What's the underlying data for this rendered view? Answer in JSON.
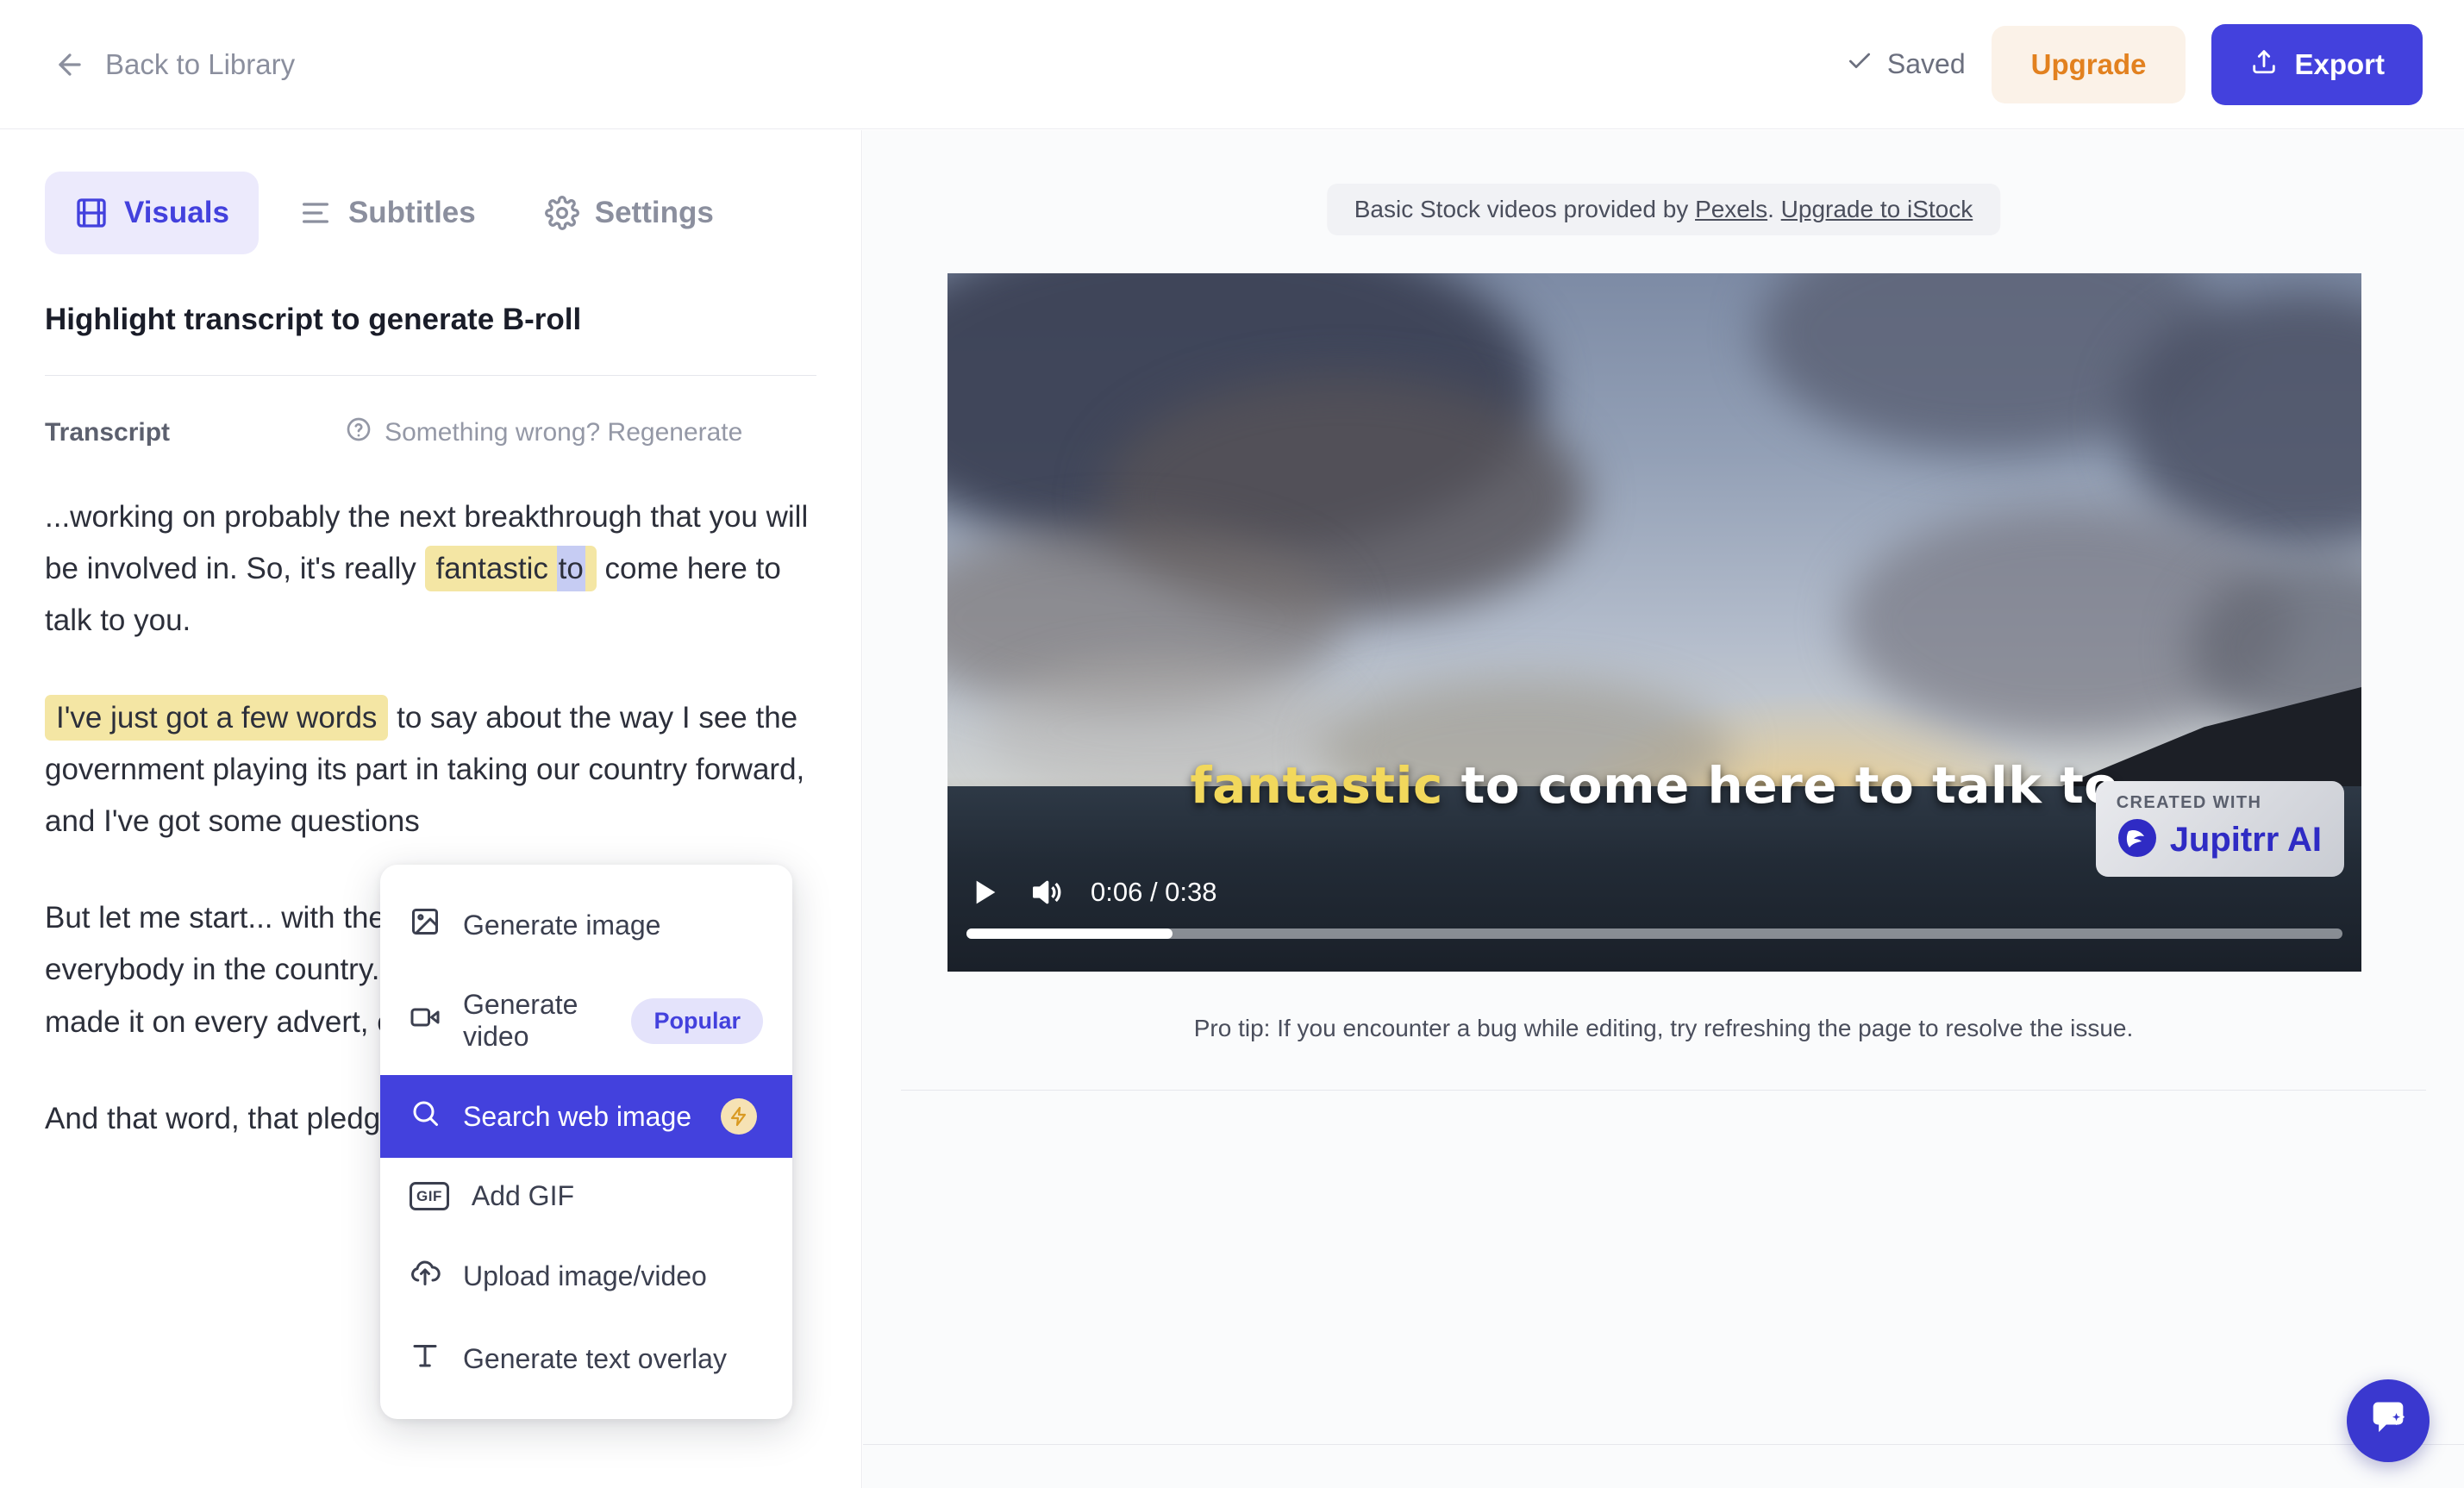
{
  "header": {
    "back_label": "Back to Library",
    "saved_label": "Saved",
    "upgrade_label": "Upgrade",
    "export_label": "Export",
    "accent_blue": "#4341dd",
    "accent_orange": "#e2811f"
  },
  "tabs": [
    {
      "label": "Visuals",
      "icon": "film-icon",
      "active": true
    },
    {
      "label": "Subtitles",
      "icon": "lines-icon",
      "active": false
    },
    {
      "label": "Settings",
      "icon": "gear-icon",
      "active": false
    }
  ],
  "panel": {
    "title": "Highlight transcript to generate B-roll",
    "transcript_label": "Transcript",
    "regenerate_label": "Something wrong? Regenerate"
  },
  "transcript": {
    "p1_a": "...working on probably the next breakthrough that you will be involved in. So, it's really ",
    "p1_hl_yellow": "fantastic ",
    "p1_hl_blue": "to",
    "p1_b": " come here to talk to you.",
    "p2_hl": "I've just got a few words",
    "p2_rest": " to say about the way I see the government playing its part in taking our country forward, and I've got some questions",
    "p3": "But let me start... with the pledge I made to you and everybody in the country. It was a really simple pledge. I made it on every advert, on every speech.",
    "p4": "And that word, that pledge"
  },
  "context_menu": {
    "items": [
      {
        "label": "Generate image",
        "icon": "image-icon",
        "badge": "",
        "highlighted": false
      },
      {
        "label": "Generate video",
        "icon": "video-camera-icon",
        "badge": "Popular",
        "highlighted": false
      },
      {
        "label": "Search web image",
        "icon": "search-icon",
        "badge": "bolt",
        "highlighted": true
      },
      {
        "label": "Add GIF",
        "icon": "gif-icon",
        "badge": "",
        "highlighted": false
      },
      {
        "label": "Upload image/video",
        "icon": "cloud-upload-icon",
        "badge": "",
        "highlighted": false
      },
      {
        "label": "Generate text overlay",
        "icon": "text-icon",
        "badge": "",
        "highlighted": false
      }
    ]
  },
  "preview": {
    "stock_note_prefix": "Basic Stock videos provided by ",
    "stock_link_1": "Pexels",
    "stock_note_mid": ". ",
    "stock_link_2": "Upgrade to iStock",
    "subtitle_keyword": "fantastic",
    "subtitle_rest": " to come here to talk to",
    "current_time": "0:06",
    "total_time": "0:38",
    "time_display": "0:06 / 0:38",
    "progress_percent": 15,
    "watermark_top": "CREATED WITH",
    "watermark_name": "Jupitrr AI",
    "pro_tip": "Pro tip: If you encounter a bug while editing, try refreshing the page to resolve the issue."
  },
  "chat": {
    "icon": "chat-sparkle-icon"
  }
}
